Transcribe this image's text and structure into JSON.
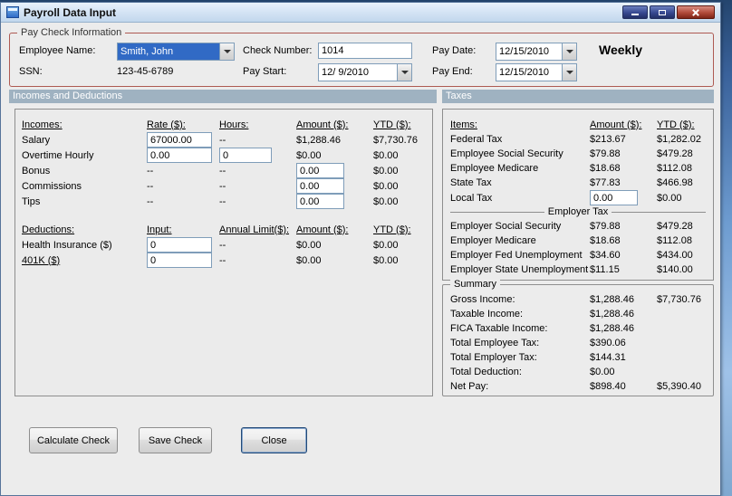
{
  "window": {
    "title": "Payroll Data Input"
  },
  "colors": {
    "selection": "#316AC5",
    "group_border": "#AE5A52",
    "section_header": "#9FB2C1"
  },
  "paycheck": {
    "group_label": "Pay Check Information",
    "employee_name": {
      "label": "Employee Name:",
      "value": "Smith, John"
    },
    "ssn": {
      "label": "SSN:",
      "value": "123-45-6789"
    },
    "check_number": {
      "label": "Check Number:",
      "value": "1014"
    },
    "pay_start": {
      "label": "Pay Start:",
      "value": "12/ 9/2010"
    },
    "pay_date": {
      "label": "Pay Date:",
      "value": "12/15/2010"
    },
    "pay_end": {
      "label": "Pay End:",
      "value": "12/15/2010"
    },
    "frequency": "Weekly"
  },
  "incomes": {
    "section_header": "Incomes and Deductions",
    "headers": {
      "item": "Incomes:",
      "rate": "Rate ($):",
      "hours": "Hours:",
      "amount": "Amount ($):",
      "ytd": "YTD ($):"
    },
    "rows": [
      {
        "label": "Salary",
        "rate": "67000.00",
        "hours": "--",
        "amount": "$1,288.46",
        "ytd": "$7,730.76"
      },
      {
        "label": "Overtime Hourly",
        "rate": "0.00",
        "hours": "0",
        "amount": "$0.00",
        "ytd": "$0.00"
      },
      {
        "label": "Bonus",
        "rate": "--",
        "hours": "--",
        "amount": "0.00",
        "ytd": "$0.00"
      },
      {
        "label": "Commissions",
        "rate": "--",
        "hours": "--",
        "amount": "0.00",
        "ytd": "$0.00"
      },
      {
        "label": "Tips",
        "rate": "--",
        "hours": "--",
        "amount": "0.00",
        "ytd": "$0.00"
      }
    ],
    "deduction_headers": {
      "item": "Deductions:",
      "input": "Input:",
      "limit": "Annual Limit($):",
      "amount": "Amount ($):",
      "ytd": "YTD ($):"
    },
    "deduction_rows": [
      {
        "label": "Health Insurance  ($)",
        "input": "0",
        "limit": "--",
        "amount": "$0.00",
        "ytd": "$0.00"
      },
      {
        "label": "401K  ($)",
        "input": "0",
        "limit": "--",
        "amount": "$0.00",
        "ytd": "$0.00"
      }
    ]
  },
  "taxes": {
    "section_header": "Taxes",
    "headers": {
      "item": "Items:",
      "amount": "Amount ($):",
      "ytd": "YTD ($):"
    },
    "employee_rows": [
      {
        "label": "Federal Tax",
        "amount": "$213.67",
        "ytd": "$1,282.02"
      },
      {
        "label": "Employee Social Security",
        "amount": "$79.88",
        "ytd": "$479.28"
      },
      {
        "label": "Employee Medicare",
        "amount": "$18.68",
        "ytd": "$112.08"
      },
      {
        "label": "State Tax",
        "amount": "$77.83",
        "ytd": "$466.98"
      },
      {
        "label": "Local Tax",
        "amount": "0.00",
        "ytd": "$0.00"
      }
    ],
    "employer_header": "Employer Tax",
    "employer_rows": [
      {
        "label": "Employer Social Security",
        "amount": "$79.88",
        "ytd": "$479.28"
      },
      {
        "label": "Employer Medicare",
        "amount": "$18.68",
        "ytd": "$112.08"
      },
      {
        "label": "Employer Fed Unemployment",
        "amount": "$34.60",
        "ytd": "$434.00"
      },
      {
        "label": "Employer State Unemployment",
        "amount": "$11.15",
        "ytd": "$140.00"
      }
    ]
  },
  "summary": {
    "group_label": "Summary",
    "rows": [
      {
        "label": "Gross Income:",
        "amount": "$1,288.46",
        "ytd": "$7,730.76"
      },
      {
        "label": "Taxable Income:",
        "amount": "$1,288.46",
        "ytd": ""
      },
      {
        "label": "FICA Taxable Income:",
        "amount": "$1,288.46",
        "ytd": ""
      },
      {
        "label": "Total Employee Tax:",
        "amount": "$390.06",
        "ytd": ""
      },
      {
        "label": "Total Employer Tax:",
        "amount": "$144.31",
        "ytd": ""
      },
      {
        "label": "Total Deduction:",
        "amount": "$0.00",
        "ytd": ""
      },
      {
        "label": "Net Pay:",
        "amount": "$898.40",
        "ytd": "$5,390.40"
      }
    ]
  },
  "buttons": {
    "calculate": "Calculate Check",
    "save": "Save Check",
    "close": "Close"
  }
}
